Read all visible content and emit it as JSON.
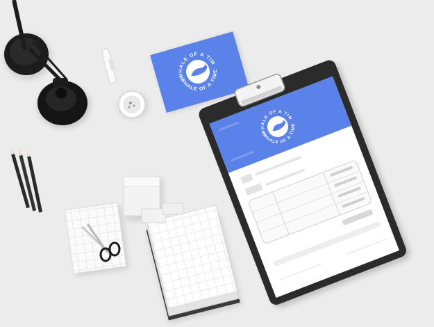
{
  "brand": {
    "name_top": "WHALE OF A TIME",
    "name_bottom": "WHALE OF A TIME",
    "color": "#5b82e8"
  },
  "business_card": {
    "logo_text_top": "WHALE OF A TIME",
    "logo_text_bottom": "WHALE OF A TIME"
  },
  "clipboard": {
    "logo_text_top": "WHALE OF A TIME",
    "logo_text_bottom": "WHALE OF A TIME"
  },
  "colors": {
    "background": "#ececec",
    "clipboard": "#2b2b2b",
    "lamp": "#1c1c1c",
    "paper": "#ffffff",
    "accent": "#5b82e8"
  },
  "icons": [
    "whale-icon",
    "scissors-icon",
    "pencil-icon",
    "desk-lamp-icon",
    "cup-icon",
    "clipboard-icon"
  ]
}
